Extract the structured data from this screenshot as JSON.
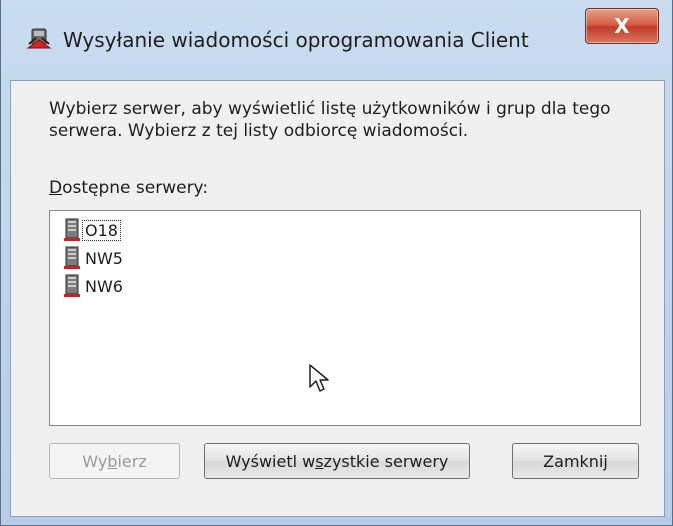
{
  "dialog": {
    "title": "Wysyłanie wiadomości oprogramowania Client",
    "close_glyph": "X",
    "description": "Wybierz serwer, aby wyświetlić listę użytkowników i grup dla tego serwera. Wybierz z tej listy odbiorcę wiadomości.",
    "servers_label": {
      "before": "",
      "accel": "D",
      "after": "ostępne serwery:"
    },
    "servers": [
      {
        "name": "O18",
        "icon": "server-icon",
        "focused": true
      },
      {
        "name": "NW5",
        "icon": "server-icon",
        "focused": false
      },
      {
        "name": "NW6",
        "icon": "server-icon",
        "focused": false
      }
    ],
    "buttons": {
      "select": {
        "before": "Wy",
        "accel": "b",
        "after": "ierz",
        "enabled": false
      },
      "show_all": {
        "before": "Wyświetl w",
        "accel": "s",
        "after": "zystkie serwery",
        "enabled": true
      },
      "close": {
        "before": "Zamknij",
        "accel": "",
        "after": "",
        "enabled": true
      }
    }
  },
  "colors": {
    "frame": "#c9dcf0",
    "close_button": "#c0392b",
    "client_bg": "#f0f0f0",
    "server_icon": "#cc2222"
  }
}
